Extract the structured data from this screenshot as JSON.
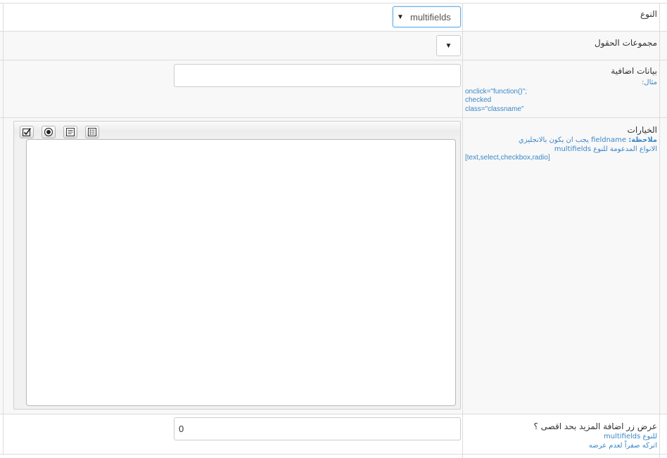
{
  "rows": {
    "type": {
      "label": "النوع",
      "selected": "multifields"
    },
    "field_groups": {
      "label": "مجموعات الحقول",
      "selected": ""
    },
    "extra_data": {
      "label": "بيانات اضافية",
      "value": "",
      "hint_title": "مثال:",
      "hint_lines": [
        "onclick=\"function()\";",
        "checked",
        "class=\"classname\""
      ]
    },
    "options": {
      "label": "الخيارات",
      "note_prefix": "ملاحظة:",
      "note_text": " fieldname يجب ان يكون بالانجليزي",
      "supported_types": "الانواع المدعومة للنوع multifields",
      "types_list": "[text,select,checkbox,radio]",
      "toolbar": [
        "checkbox-icon",
        "radio-icon",
        "textarea-icon",
        "list-icon"
      ],
      "editor_content": ""
    },
    "max_add_more": {
      "label": "عرض زر اضافة المزيد بحد اقصى ؟",
      "value": "0",
      "hint_line1": "للنوع multifields",
      "hint_line2": "اتركه صفراً لعدم عرضه"
    }
  },
  "colors": {
    "hint": "#3a87c8",
    "border": "#dcdcdc",
    "focus": "#66afe9"
  }
}
